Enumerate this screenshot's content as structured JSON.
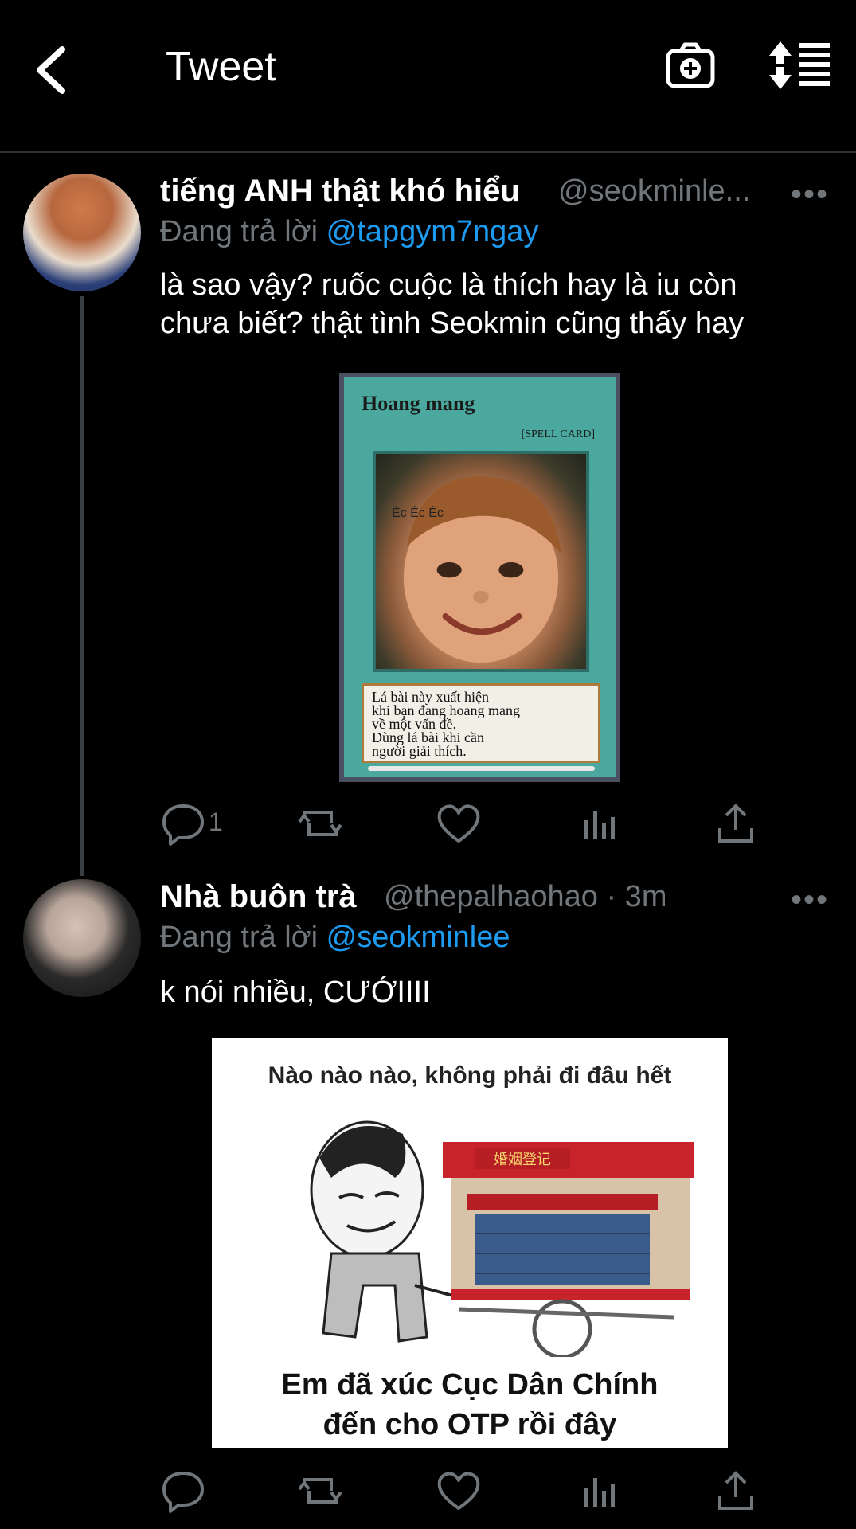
{
  "header": {
    "title": "Tweet"
  },
  "tweets": [
    {
      "name": "tiếng ANH thật khó hiểu",
      "handle": "@seokminle...",
      "reply_prefix": "Đang trả lời",
      "reply_to": "@tapgym7ngay",
      "text_line1": "là sao vậy? ruốc cuộc là thích hay là iu còn",
      "text_line2": "chưa biết? thật tình Seokmin cũng thấy hay",
      "media": {
        "card_title": "Hoang mang",
        "card_type": "[SPELL CARD]",
        "card_overlay": "Éc Éc Éc",
        "card_desc_line1": "Lá bài này xuất hiện",
        "card_desc_line2": "khi bạn đang hoang mang",
        "card_desc_line3": "về một vấn đề.",
        "card_desc_line4": "Dùng lá bài khi cần",
        "card_desc_line5": "người giải thích."
      },
      "reply_count": "1"
    },
    {
      "name": "Nhà buôn trà",
      "handle": "@thepalhaohao · 3m",
      "reply_prefix": "Đang trả lời",
      "reply_to": "@seokminlee",
      "text": "k nói nhiều, CƯỚIIII",
      "media": {
        "top_text": "Nào nào nào, không phải đi đâu hết",
        "sign_text": "婚姻登记",
        "bottom_line1": "Em đã xúc Cục Dân Chính",
        "bottom_line2": "đến cho OTP rồi đây"
      }
    }
  ],
  "icons": {
    "back": "chevron-left-icon",
    "camera": "camera-plus-icon",
    "sort": "sort-icon",
    "reply": "reply-icon",
    "retweet": "retweet-icon",
    "like": "heart-icon",
    "stats": "stats-icon",
    "share": "share-icon"
  },
  "colors": {
    "background": "#000000",
    "text": "#ffffff",
    "secondary": "#71767b",
    "mention": "#1d9bf0"
  }
}
